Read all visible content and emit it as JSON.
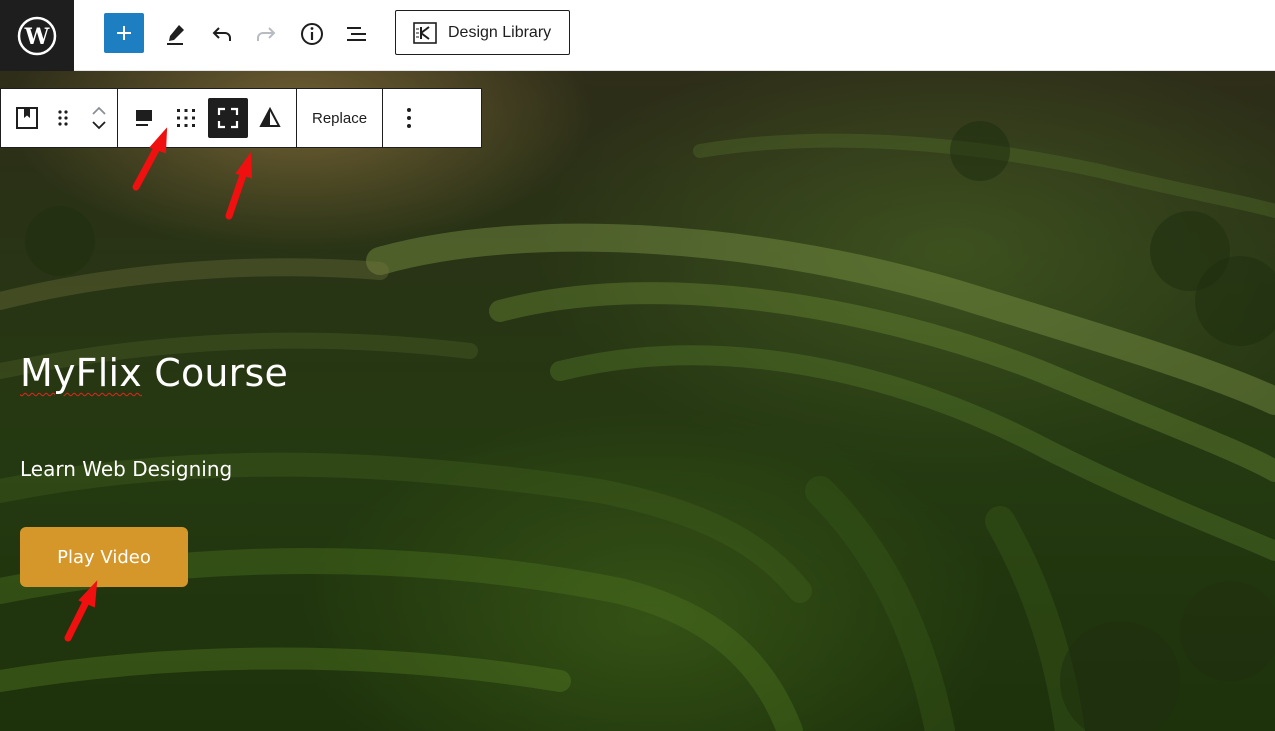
{
  "topbar": {
    "design_library_label": "Design Library",
    "icons": [
      "wordpress-logo-icon",
      "plus-icon",
      "pencil-icon",
      "undo-icon",
      "redo-icon",
      "info-icon",
      "list-view-icon",
      "design-library-icon"
    ]
  },
  "block_toolbar": {
    "replace_label": "Replace",
    "icons": [
      "cover-block-icon",
      "drag-handle-icon",
      "chevron-up-icon",
      "chevron-down-icon",
      "align-icon",
      "matrix-position-icon",
      "full-height-icon",
      "contrast-icon",
      "more-options-icon"
    ],
    "active_tool": "full-height"
  },
  "hero": {
    "title_spell_flagged": "MyFlix",
    "title_rest": " Course",
    "subtitle": "Learn Web Designing",
    "button_label": "Play Video"
  },
  "colors": {
    "wp_dark": "#1e1e1e",
    "add_button_blue": "#1e7ec2",
    "play_button": "#d5962a",
    "annotation_arrow": "#f01010"
  }
}
